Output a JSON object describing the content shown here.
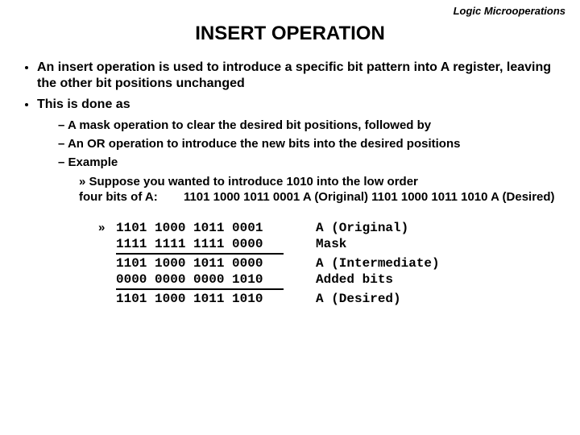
{
  "topic": "Logic Microoperations",
  "title": "INSERT OPERATION",
  "bullets": {
    "b1a": "An insert operation is used to introduce a specific bit pattern into A register, leaving the other bit positions unchanged",
    "b1b": "This is done as",
    "b2a": "A mask operation to clear the desired bit positions, followed by",
    "b2b": "An OR operation to introduce the new bits into the desired positions",
    "b2c": "Example",
    "b3a_line1": "Suppose you wanted to introduce 1010 into the low order",
    "b3a_line2_left": "four bits of A:",
    "b3a_bits1": "1101 1000 1011 0001  A (Original)",
    "b3a_bits2": "1101 1000 1011 1010  A (Desired)"
  },
  "mono": {
    "r1": {
      "bits": "1101 1000 1011 0001",
      "label": "A (Original)"
    },
    "r2": {
      "bits": "1111 1111 1111 0000",
      "label": "Mask"
    },
    "r3": {
      "bits": "1101 1000 1011 0000",
      "label": "A (Intermediate)"
    },
    "r4": {
      "bits": "0000 0000 0000 1010",
      "label": "Added bits"
    },
    "r5": {
      "bits": "1101 1000 1011 1010",
      "label": "A (Desired)"
    }
  }
}
